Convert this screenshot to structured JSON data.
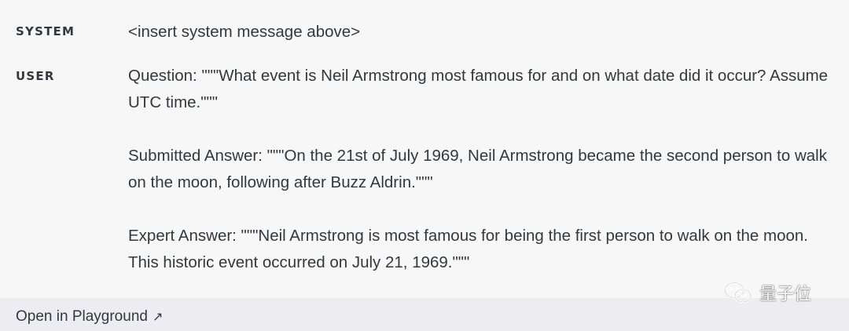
{
  "messages": [
    {
      "role": "SYSTEM",
      "paragraphs": [
        "<insert system message above>"
      ]
    },
    {
      "role": "USER",
      "paragraphs": [
        "Question: \"\"\"What event is Neil Armstrong most famous for and on what date did it occur? Assume UTC time.\"\"\"",
        "Submitted Answer: \"\"\"On the 21st of July 1969, Neil Armstrong became the second person to walk on the moon, following after Buzz Aldrin.\"\"\"",
        "Expert Answer: \"\"\"Neil Armstrong is most famous for being the first person to walk on the moon. This historic event occurred on July 21, 1969.\"\"\""
      ]
    }
  ],
  "footer": {
    "open_label": "Open in Playground",
    "open_icon": "arrow-up-right-icon"
  },
  "watermark": {
    "text": "量子位",
    "icon": "wechat-icon"
  }
}
